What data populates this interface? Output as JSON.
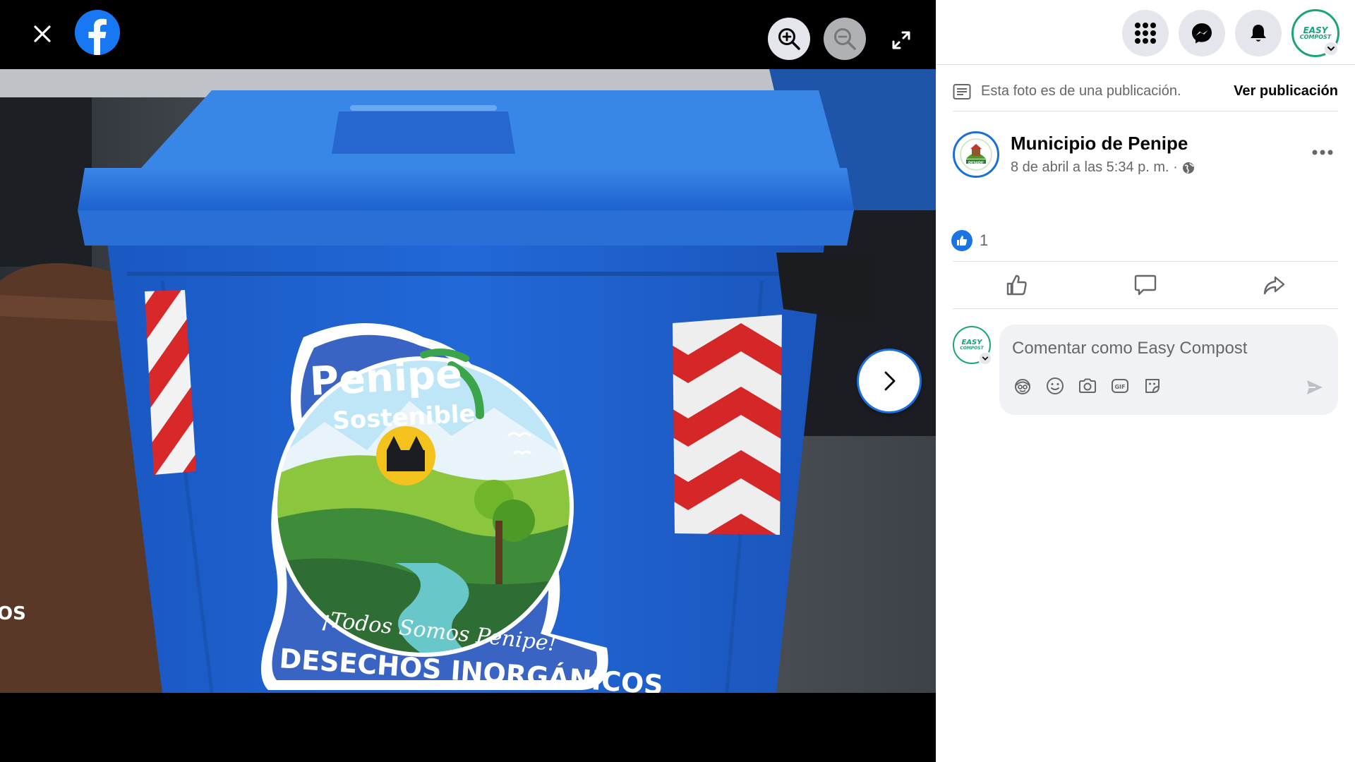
{
  "viewer": {
    "close_icon": "close-icon",
    "logo_icon": "facebook-logo-icon",
    "zoom_in_icon": "zoom-in-icon",
    "zoom_out_icon": "zoom-out-icon",
    "fullscreen_icon": "fullscreen-icon",
    "next_icon": "chevron-right-icon",
    "photo": {
      "brand_line1": "Penipe",
      "brand_line2": "Sostenible",
      "bin_label": "DESECHOS INORGÁNICOS",
      "slogan": "¡Todos Somos Penipe!",
      "side_text": "OS"
    }
  },
  "topbar": {
    "menu_icon": "grid-menu-icon",
    "messenger_icon": "messenger-icon",
    "notifications_icon": "bell-icon",
    "profile_logo_line1": "EASY",
    "profile_logo_line2": "COMPOST"
  },
  "post_note": {
    "text": "Esta foto es de una publicación.",
    "link": "Ver publicación"
  },
  "author": {
    "name": "Municipio de Penipe",
    "date": "8 de abril a las 5:34 p. m. ·",
    "avatar_text": "PENIPE"
  },
  "reactions": {
    "count": "1"
  },
  "comment": {
    "placeholder": "Comentar como Easy Compost",
    "avatar_line1": "EASY",
    "avatar_line2": "COMPOST"
  },
  "colors": {
    "facebook_blue": "#1877f2",
    "secondary_text": "#65676b",
    "button_gray": "#e4e6eb",
    "bin_blue": "#1d5bb8"
  }
}
